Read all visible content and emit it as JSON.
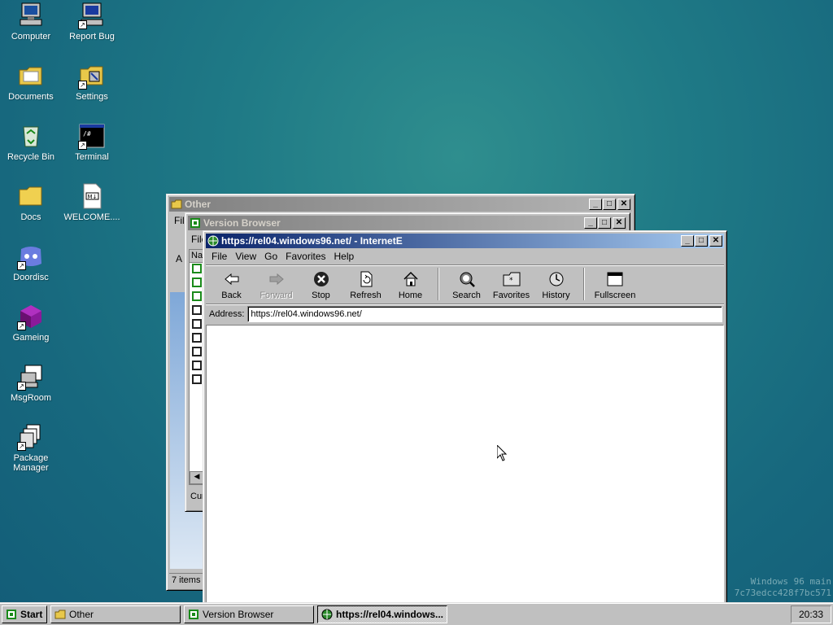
{
  "desktop": {
    "icons": [
      {
        "label": "Computer",
        "icon": "computer-icon"
      },
      {
        "label": "Report Bug",
        "icon": "report-bug-icon"
      },
      {
        "label": "Documents",
        "icon": "folder-documents-icon"
      },
      {
        "label": "Settings",
        "icon": "settings-icon"
      },
      {
        "label": "Recycle Bin",
        "icon": "recycle-bin-icon"
      },
      {
        "label": "Terminal",
        "icon": "terminal-icon"
      },
      {
        "label": "Docs",
        "icon": "folder-icon"
      },
      {
        "label": "WELCOME....",
        "icon": "markdown-file-icon"
      },
      {
        "label": "Doordisc",
        "icon": "doordisc-icon"
      },
      {
        "label": "Gameing",
        "icon": "cube-icon"
      },
      {
        "label": "MsgRoom",
        "icon": "msgroom-icon"
      },
      {
        "label": "Package Manager",
        "icon": "package-manager-icon"
      }
    ]
  },
  "windows": {
    "other": {
      "title": "Other",
      "menu_fragment": "Fil",
      "address_fragment": "A",
      "status": "7 items"
    },
    "version_browser": {
      "title": "Version Browser",
      "menu_fragment": "File",
      "column_fragment": "Na",
      "status_fragment": "Cur"
    },
    "browser": {
      "title": "https://rel04.windows96.net/ - InternetE",
      "menu": [
        "File",
        "View",
        "Go",
        "Favorites",
        "Help"
      ],
      "toolbar": {
        "back": "Back",
        "forward": "Forward",
        "stop": "Stop",
        "refresh": "Refresh",
        "home": "Home",
        "search": "Search",
        "favorites": "Favorites",
        "history": "History",
        "fullscreen": "Fullscreen"
      },
      "address_label": "Address:",
      "address_value": "https://rel04.windows96.net/"
    }
  },
  "taskbar": {
    "start": "Start",
    "items": [
      "Other",
      "Version Browser",
      "https://rel04.windows..."
    ],
    "clock": "20:33"
  },
  "watermark": {
    "line1": "Windows 96 main",
    "line2": "7c73edcc428f7bc571"
  },
  "colors": {
    "desktop": "#1f7a86",
    "active_title": "#0a246a",
    "inactive_title": "#808080",
    "chrome": "#c0c0c0"
  }
}
